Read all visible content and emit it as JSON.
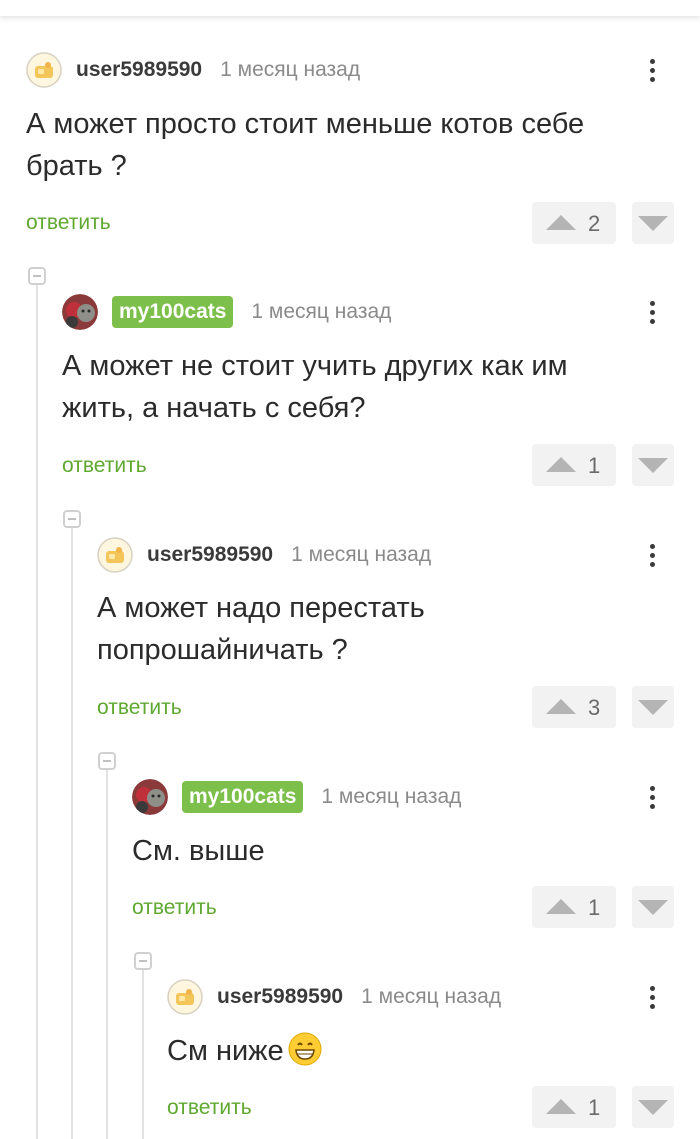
{
  "colors": {
    "accent": "#7cc04b",
    "reply_link": "#5fa830",
    "vote_bg": "#f2f2f2",
    "arrow": "#b4b4b4"
  },
  "icons": {
    "vote_up": "triangle-up-icon",
    "vote_down": "triangle-down-icon",
    "more": "vertical-ellipsis-icon",
    "collapse": "minus-square-icon",
    "emoji": "grinning-face-icon"
  },
  "comments": [
    {
      "username": "user5989590",
      "date": "1 месяц назад",
      "text_lines": [
        "А может просто стоит меньше котов себе",
        "брать ?"
      ],
      "reply_label": "ответить",
      "votes": "2"
    },
    {
      "username": "my100cats",
      "date": "1 месяц назад",
      "text_lines": [
        "А может не стоит учить других как им",
        "жить, а начать с себя?"
      ],
      "reply_label": "ответить",
      "votes": "1"
    },
    {
      "username": "user5989590",
      "date": "1 месяц назад",
      "text_lines": [
        "А может надо перестать",
        "попрошайничать ?"
      ],
      "reply_label": "ответить",
      "votes": "3"
    },
    {
      "username": "my100cats",
      "date": "1 месяц назад",
      "text_lines": [
        "См. выше"
      ],
      "reply_label": "ответить",
      "votes": "1"
    },
    {
      "username": "user5989590",
      "date": "1 месяц назад",
      "text_lines": [
        "См ниже"
      ],
      "reply_label": "ответить",
      "votes": "1"
    }
  ]
}
